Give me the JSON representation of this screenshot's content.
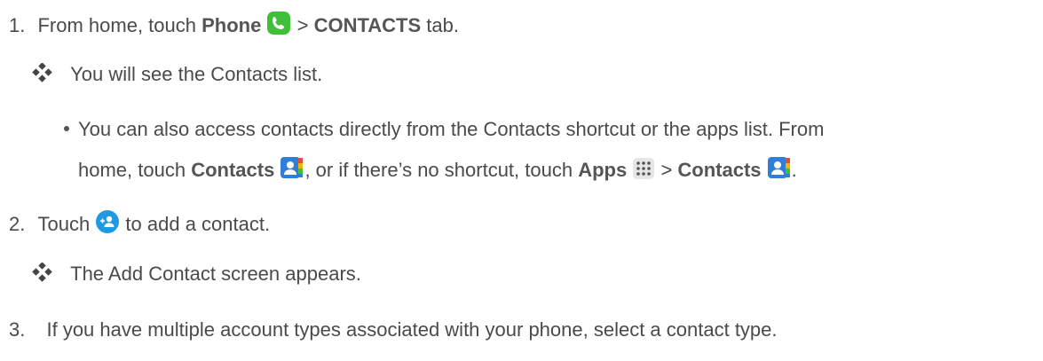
{
  "steps": [
    {
      "number": "1.",
      "pre": "From home, touch ",
      "bold1": "Phone",
      "icon1": "phone-icon",
      "sep": " > ",
      "bold2": "CONTACTS",
      "post": " tab."
    },
    {
      "number": "2.",
      "pre": "Touch ",
      "icon": "add-contact-icon",
      "post": " to add a contact."
    },
    {
      "number": "3.",
      "text": "If you have multiple account types associated with your phone, select a contact type."
    }
  ],
  "results": [
    {
      "icon": "diamond-bullet-icon",
      "text": "You will see the Contacts list."
    },
    {
      "icon": "diamond-bullet-icon",
      "text": "The Add Contact screen appears."
    }
  ],
  "note": {
    "line1": "You can also access contacts directly from the Contacts shortcut or the apps list. From",
    "l2_pre": "home, touch ",
    "l2_bold1": "Contacts",
    "l2_icon1": "contacts-icon",
    "l2_mid": ", or if there’s no shortcut, touch ",
    "l2_bold2": "Apps",
    "l2_icon2": "apps-icon",
    "l2_sep": " > ",
    "l2_bold3": "Contacts",
    "l2_icon3": "contacts-icon",
    "l2_end": "."
  },
  "colors": {
    "phone_icon": "#3fbf3a",
    "add_contact_icon": "#1f9ae0",
    "contacts_icon_blue": "#2f7fd6"
  }
}
